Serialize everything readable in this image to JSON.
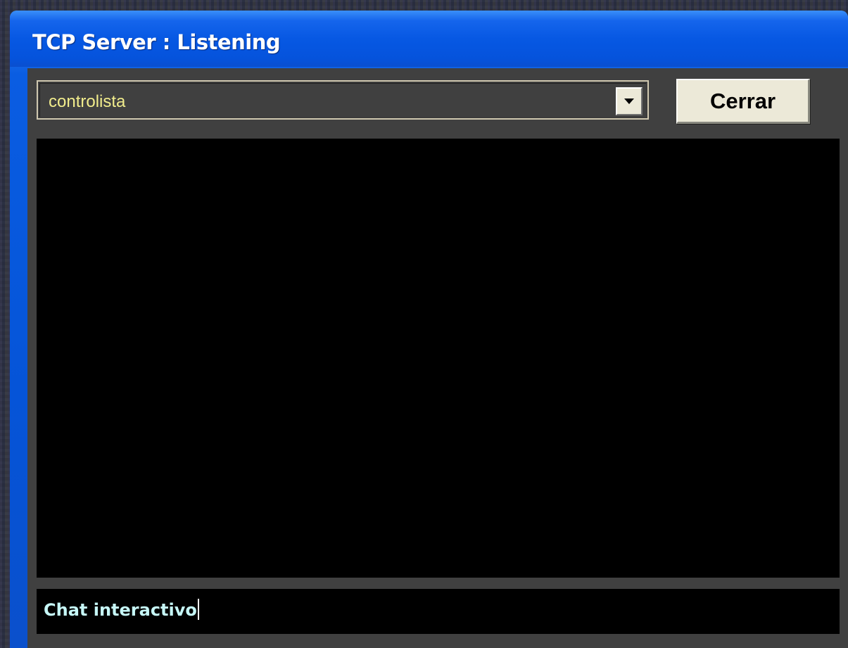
{
  "window": {
    "title": "TCP Server : Listening"
  },
  "combo": {
    "selected_value": "controlista",
    "dropdown_icon": "triangle-down-icon"
  },
  "buttons": {
    "close_label": "Cerrar"
  },
  "output": {
    "lines": []
  },
  "chat": {
    "value": "Chat interactivo"
  },
  "colors": {
    "title_bar": "#0554d8",
    "client_bg": "#404040",
    "panel_bg": "#000000",
    "combo_text": "#f1ec8c",
    "chat_text": "#c6f7f7",
    "button_face": "#ece9d8"
  }
}
